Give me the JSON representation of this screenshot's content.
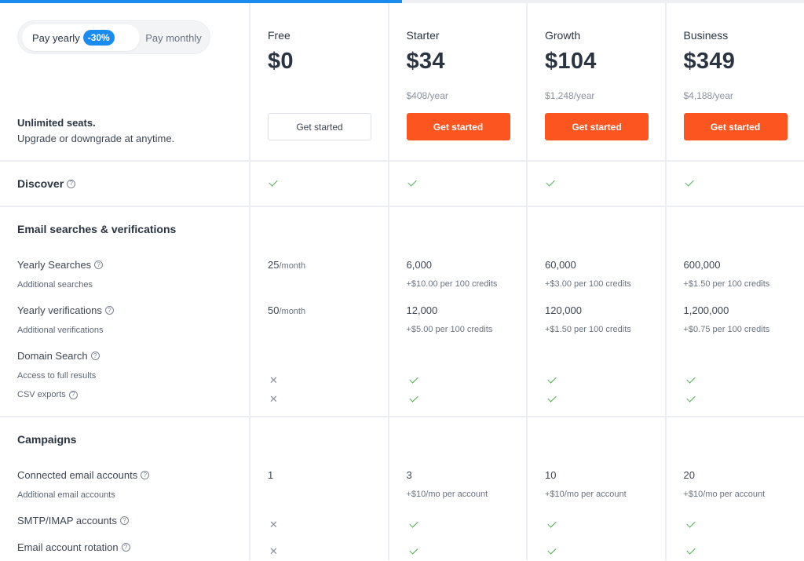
{
  "progress": {
    "percent": 50,
    "colors": {
      "fill": "#1a8cf0",
      "track": "#eef0f4"
    }
  },
  "billing": {
    "yearly_label": "Pay yearly",
    "discount_badge": "-30%",
    "monthly_label": "Pay monthly",
    "selected": "yearly"
  },
  "intro": {
    "title": "Unlimited seats.",
    "subtitle": "Upgrade or downgrade at anytime."
  },
  "colors": {
    "accent": "#fd5520",
    "badge": "#1a8cf0",
    "check": "#4caf50"
  },
  "plans": [
    {
      "name": "Free",
      "price": "$0",
      "yearly": "",
      "cta": "Get started",
      "cta_style": "outline"
    },
    {
      "name": "Starter",
      "price": "$34",
      "yearly": "$408/year",
      "cta": "Get started",
      "cta_style": "filled"
    },
    {
      "name": "Growth",
      "price": "$104",
      "yearly": "$1,248/year",
      "cta": "Get started",
      "cta_style": "filled"
    },
    {
      "name": "Business",
      "price": "$349",
      "yearly": "$4,188/year",
      "cta": "Get started",
      "cta_style": "filled"
    }
  ],
  "discover": {
    "label": "Discover",
    "values": [
      "check",
      "check",
      "check",
      "check"
    ]
  },
  "email_section": {
    "title": "Email searches & verifications",
    "yearly_searches": {
      "label": "Yearly Searches",
      "sub_label": "Additional searches",
      "values": [
        {
          "main": "25",
          "unit": "/month",
          "sub": ""
        },
        {
          "main": "6,000",
          "unit": "",
          "sub": "+$10.00 per 100 credits"
        },
        {
          "main": "60,000",
          "unit": "",
          "sub": "+$3.00 per 100 credits"
        },
        {
          "main": "600,000",
          "unit": "",
          "sub": "+$1.50 per 100 credits"
        }
      ]
    },
    "yearly_verifications": {
      "label": "Yearly verifications",
      "sub_label": "Additional verifications",
      "values": [
        {
          "main": "50",
          "unit": "/month",
          "sub": ""
        },
        {
          "main": "12,000",
          "unit": "",
          "sub": "+$5.00 per 100 credits"
        },
        {
          "main": "120,000",
          "unit": "",
          "sub": "+$1.50 per 100 credits"
        },
        {
          "main": "1,200,000",
          "unit": "",
          "sub": "+$0.75 per 100 credits"
        }
      ]
    },
    "domain_search": {
      "label": "Domain Search",
      "access_label": "Access to full results",
      "access_values": [
        "cross",
        "check",
        "check",
        "check"
      ],
      "csv_label": "CSV exports",
      "csv_values": [
        "cross",
        "check",
        "check",
        "check"
      ]
    }
  },
  "campaigns": {
    "title": "Campaigns",
    "connected_accounts": {
      "label": "Connected email accounts",
      "sub_label": "Additional email accounts",
      "values": [
        {
          "main": "1",
          "sub": ""
        },
        {
          "main": "3",
          "sub": "+$10/mo per account"
        },
        {
          "main": "10",
          "sub": "+$10/mo per account"
        },
        {
          "main": "20",
          "sub": "+$10/mo per account"
        }
      ]
    },
    "smtp_imap": {
      "label": "SMTP/IMAP accounts",
      "values": [
        "cross",
        "check",
        "check",
        "check"
      ]
    },
    "rotation": {
      "label": "Email account rotation",
      "values": [
        "cross",
        "check",
        "check",
        "check"
      ]
    }
  },
  "icons": {
    "help": "?",
    "cross": "✕"
  }
}
